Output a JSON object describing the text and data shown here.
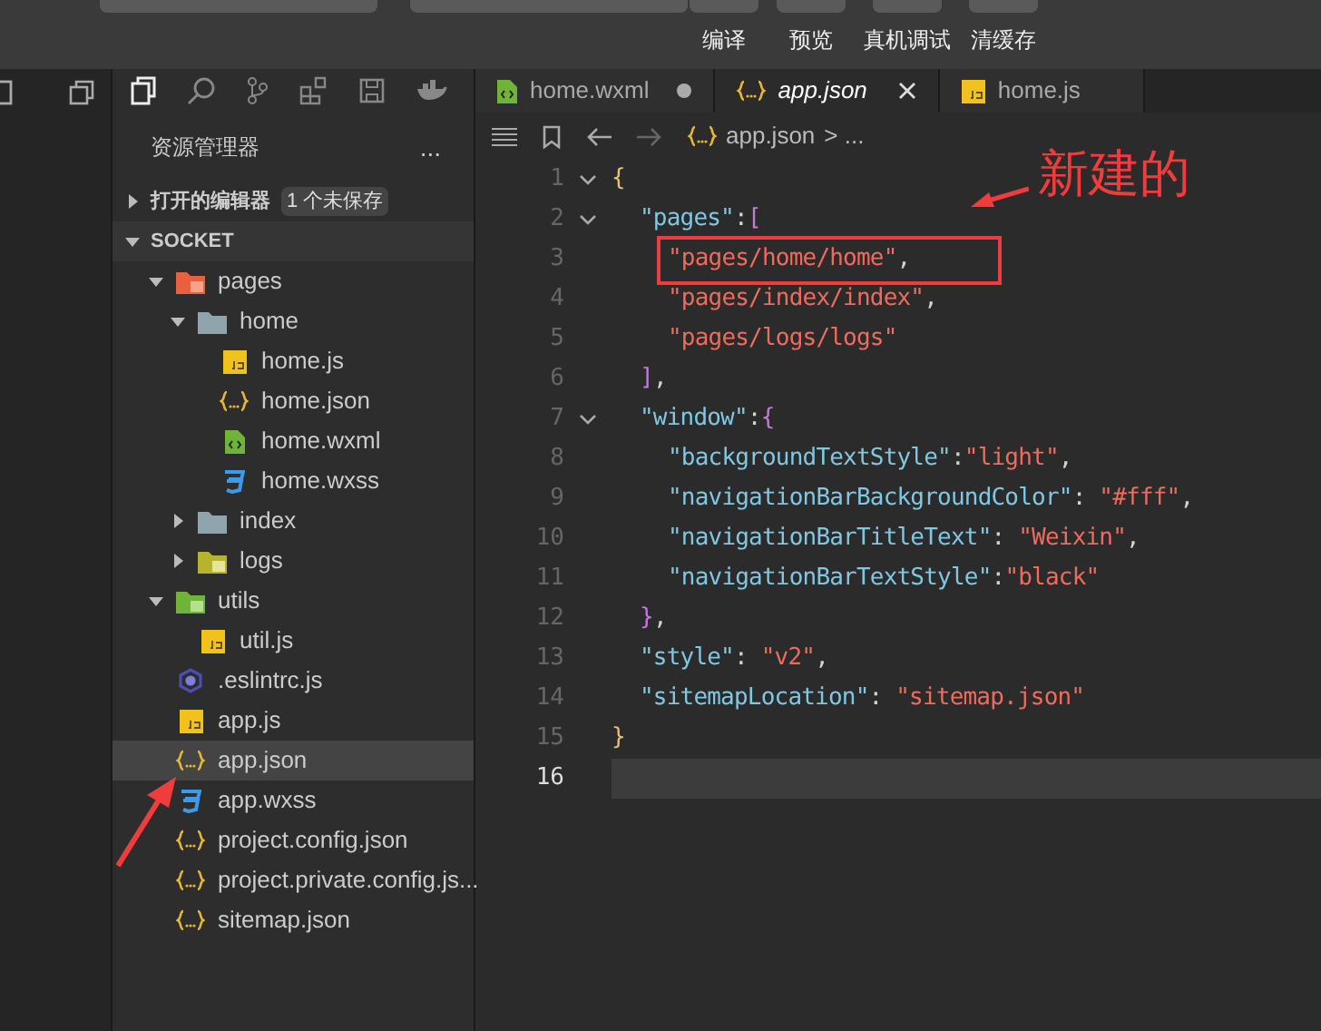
{
  "toolbar": {
    "actions": [
      "编译",
      "预览",
      "真机调试",
      "清缓存"
    ]
  },
  "tabs": [
    {
      "label": "home.wxml",
      "kind": "wxml",
      "selected": false,
      "modified": true
    },
    {
      "label": "app.json",
      "kind": "json",
      "selected": true,
      "modified": false
    },
    {
      "label": "home.js",
      "kind": "js",
      "selected": false,
      "modified": false
    }
  ],
  "sidebar": {
    "title": "资源管理器",
    "more": "...",
    "open_editors": {
      "label": "打开的编辑器",
      "badge": "1 个未保存",
      "expanded": false
    },
    "project": {
      "label": "SOCKET",
      "expanded": true,
      "items": [
        {
          "label": "pages",
          "kind": "folder-pages",
          "expanded": true,
          "selected": false,
          "children": [
            {
              "label": "home",
              "kind": "folder",
              "expanded": true,
              "selected": false,
              "children": [
                {
                  "label": "home.js",
                  "kind": "js",
                  "selected": false
                },
                {
                  "label": "home.json",
                  "kind": "json",
                  "selected": false
                },
                {
                  "label": "home.wxml",
                  "kind": "wxml",
                  "selected": false
                },
                {
                  "label": "home.wxss",
                  "kind": "wxss",
                  "selected": false
                }
              ]
            },
            {
              "label": "index",
              "kind": "folder",
              "expanded": false,
              "selected": false
            },
            {
              "label": "logs",
              "kind": "folder-logs",
              "expanded": false,
              "selected": false
            }
          ]
        },
        {
          "label": "utils",
          "kind": "folder-utils",
          "expanded": true,
          "selected": false,
          "children": [
            {
              "label": "util.js",
              "kind": "js",
              "selected": false
            }
          ]
        },
        {
          "label": ".eslintrc.js",
          "kind": "eslint",
          "selected": false
        },
        {
          "label": "app.js",
          "kind": "js",
          "selected": false
        },
        {
          "label": "app.json",
          "kind": "json",
          "selected": true
        },
        {
          "label": "app.wxss",
          "kind": "wxss",
          "selected": false
        },
        {
          "label": "project.config.json",
          "kind": "json",
          "selected": false
        },
        {
          "label": "project.private.config.js...",
          "kind": "json",
          "selected": false
        },
        {
          "label": "sitemap.json",
          "kind": "json",
          "selected": false
        }
      ]
    }
  },
  "breadcrumb": {
    "file": "app.json",
    "rest": "> ..."
  },
  "editor": {
    "lines": [
      {
        "number": "1",
        "selected": false,
        "tokens": [
          {
            "kind": "brace",
            "text": "{"
          }
        ],
        "children": [
          {
            "number": "2",
            "selected": false,
            "tokens": [
              {
                "kind": "key",
                "text": "\"pages\""
              },
              {
                "kind": "punct",
                "text": ":"
              },
              {
                "kind": "bracket",
                "text": "["
              }
            ],
            "children": [
              {
                "number": "3",
                "selected": false,
                "boxed": true,
                "tokens": [
                  {
                    "kind": "string",
                    "text": "\"pages/home/home\""
                  },
                  {
                    "kind": "punct",
                    "text": ","
                  }
                ]
              },
              {
                "number": "4",
                "selected": false,
                "tokens": [
                  {
                    "kind": "string",
                    "text": "\"pages/index/index\""
                  },
                  {
                    "kind": "punct",
                    "text": ","
                  }
                ]
              },
              {
                "number": "5",
                "selected": false,
                "tokens": [
                  {
                    "kind": "string",
                    "text": "\"pages/logs/logs\""
                  }
                ]
              }
            ]
          },
          {
            "number": "6",
            "selected": false,
            "tokens": [
              {
                "kind": "bracket",
                "text": "]"
              },
              {
                "kind": "punct",
                "text": ","
              }
            ]
          },
          {
            "number": "7",
            "selected": false,
            "tokens": [
              {
                "kind": "key",
                "text": "\"window\""
              },
              {
                "kind": "punct",
                "text": ":"
              },
              {
                "kind": "bracket",
                "text": "{"
              }
            ],
            "children": [
              {
                "number": "8",
                "selected": false,
                "tokens": [
                  {
                    "kind": "key",
                    "text": "\"backgroundTextStyle\""
                  },
                  {
                    "kind": "punct",
                    "text": ":"
                  },
                  {
                    "kind": "string",
                    "text": "\"light\""
                  },
                  {
                    "kind": "punct",
                    "text": ","
                  }
                ]
              },
              {
                "number": "9",
                "selected": false,
                "tokens": [
                  {
                    "kind": "key",
                    "text": "\"navigationBarBackgroundColor\""
                  },
                  {
                    "kind": "punct",
                    "text": ": "
                  },
                  {
                    "kind": "string",
                    "text": "\"#fff\""
                  },
                  {
                    "kind": "punct",
                    "text": ","
                  }
                ]
              },
              {
                "number": "10",
                "selected": false,
                "tokens": [
                  {
                    "kind": "key",
                    "text": "\"navigationBarTitleText\""
                  },
                  {
                    "kind": "punct",
                    "text": ": "
                  },
                  {
                    "kind": "string",
                    "text": "\"Weixin\""
                  },
                  {
                    "kind": "punct",
                    "text": ","
                  }
                ]
              },
              {
                "number": "11",
                "selected": false,
                "tokens": [
                  {
                    "kind": "key",
                    "text": "\"navigationBarTextStyle\""
                  },
                  {
                    "kind": "punct",
                    "text": ":"
                  },
                  {
                    "kind": "string",
                    "text": "\"black\""
                  }
                ]
              }
            ]
          },
          {
            "number": "12",
            "selected": false,
            "tokens": [
              {
                "kind": "bracket",
                "text": "}"
              },
              {
                "kind": "punct",
                "text": ","
              }
            ]
          },
          {
            "number": "13",
            "selected": false,
            "tokens": [
              {
                "kind": "key",
                "text": "\"style\""
              },
              {
                "kind": "punct",
                "text": ": "
              },
              {
                "kind": "string",
                "text": "\"v2\""
              },
              {
                "kind": "punct",
                "text": ","
              }
            ]
          },
          {
            "number": "14",
            "selected": false,
            "tokens": [
              {
                "kind": "key",
                "text": "\"sitemapLocation\""
              },
              {
                "kind": "punct",
                "text": ": "
              },
              {
                "kind": "string",
                "text": "\"sitemap.json\""
              }
            ]
          }
        ]
      },
      {
        "number": "15",
        "selected": false,
        "tokens": [
          {
            "kind": "brace",
            "text": "}"
          }
        ]
      },
      {
        "number": "16",
        "selected": true
      }
    ]
  },
  "annotation": {
    "text": "新建的"
  }
}
